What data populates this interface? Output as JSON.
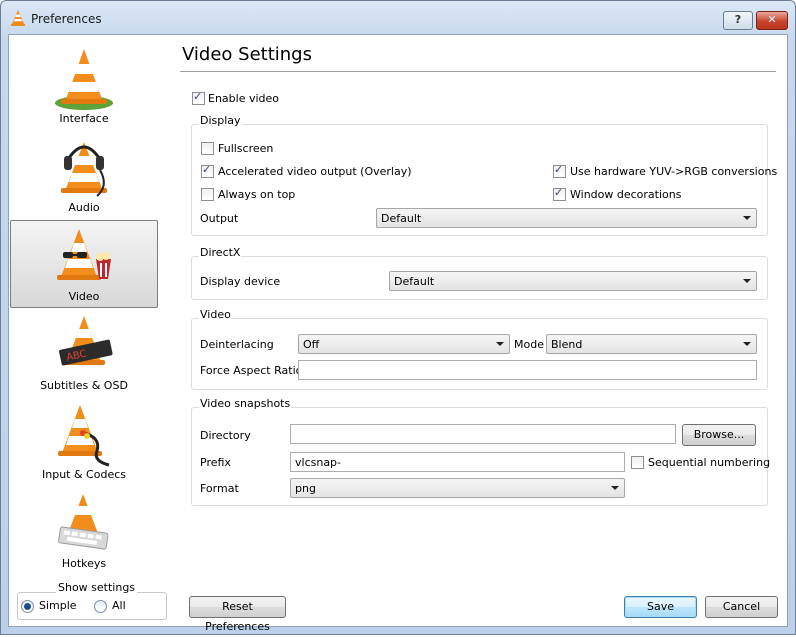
{
  "window": {
    "title": "Preferences",
    "help_label": "?",
    "close_label": "✕"
  },
  "sidebar": {
    "items": [
      {
        "label": "Interface",
        "icon": "vlc-cone-icon"
      },
      {
        "label": "Audio",
        "icon": "headphones-cone-icon"
      },
      {
        "label": "Video",
        "icon": "glasses-cone-icon"
      },
      {
        "label": "Subtitles & OSD",
        "icon": "subtitles-cone-icon"
      },
      {
        "label": "Input & Codecs",
        "icon": "cable-cone-icon"
      },
      {
        "label": "Hotkeys",
        "icon": "keyboard-cone-icon"
      }
    ],
    "selected": "Video",
    "show_settings": {
      "legend": "Show settings",
      "simple": "Simple",
      "all": "All",
      "selected": "Simple"
    }
  },
  "page": {
    "title": "Video Settings",
    "enable_video": {
      "label": "Enable video",
      "checked": true
    }
  },
  "display": {
    "title": "Display",
    "fullscreen": {
      "label": "Fullscreen",
      "checked": false
    },
    "accelerated": {
      "label": "Accelerated video output (Overlay)",
      "checked": true
    },
    "always_on_top": {
      "label": "Always on top",
      "checked": false
    },
    "hw_yuv": {
      "label": "Use hardware YUV->RGB conversions",
      "checked": true
    },
    "window_decorations": {
      "label": "Window decorations",
      "checked": true
    },
    "output_label": "Output",
    "output_value": "Default"
  },
  "directx": {
    "title": "DirectX",
    "device_label": "Display device",
    "device_value": "Default"
  },
  "video": {
    "title": "Video",
    "deinterlacing_label": "Deinterlacing",
    "deinterlacing_value": "Off",
    "mode_label": "Mode",
    "mode_value": "Blend",
    "aspect_label": "Force Aspect Ratio",
    "aspect_value": ""
  },
  "snapshots": {
    "title": "Video snapshots",
    "directory_label": "Directory",
    "directory_value": "",
    "browse_label": "Browse...",
    "prefix_label": "Prefix",
    "prefix_value": "vlcsnap-",
    "sequential": {
      "label": "Sequential numbering",
      "checked": false
    },
    "format_label": "Format",
    "format_value": "png"
  },
  "footer": {
    "reset_label": "Reset Preferences",
    "save_label": "Save",
    "cancel_label": "Cancel"
  },
  "colors": {
    "cone_orange": "#f28c1a",
    "cone_white": "#ffffff",
    "grass": "#5da33a",
    "accent": "#3c7fb1"
  }
}
